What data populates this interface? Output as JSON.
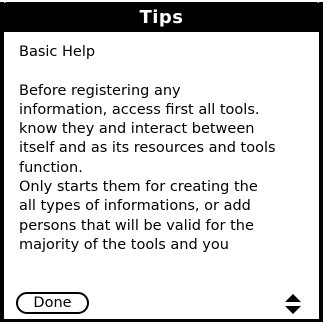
{
  "title": "Tips",
  "heading": "Basic Help",
  "lines": [
    "Before registering any",
    "information, access first all tools.",
    "know they and  interact between",
    "itself and as its resources and tools",
    "function.",
    "Only starts them for creating the",
    "all types of informations, or add",
    "persons that will be valid for the",
    "majority of the tools and you"
  ],
  "done_label": "Done",
  "icons": {
    "scroll_up": "triangle-up-icon",
    "scroll_down": "triangle-down-icon"
  }
}
